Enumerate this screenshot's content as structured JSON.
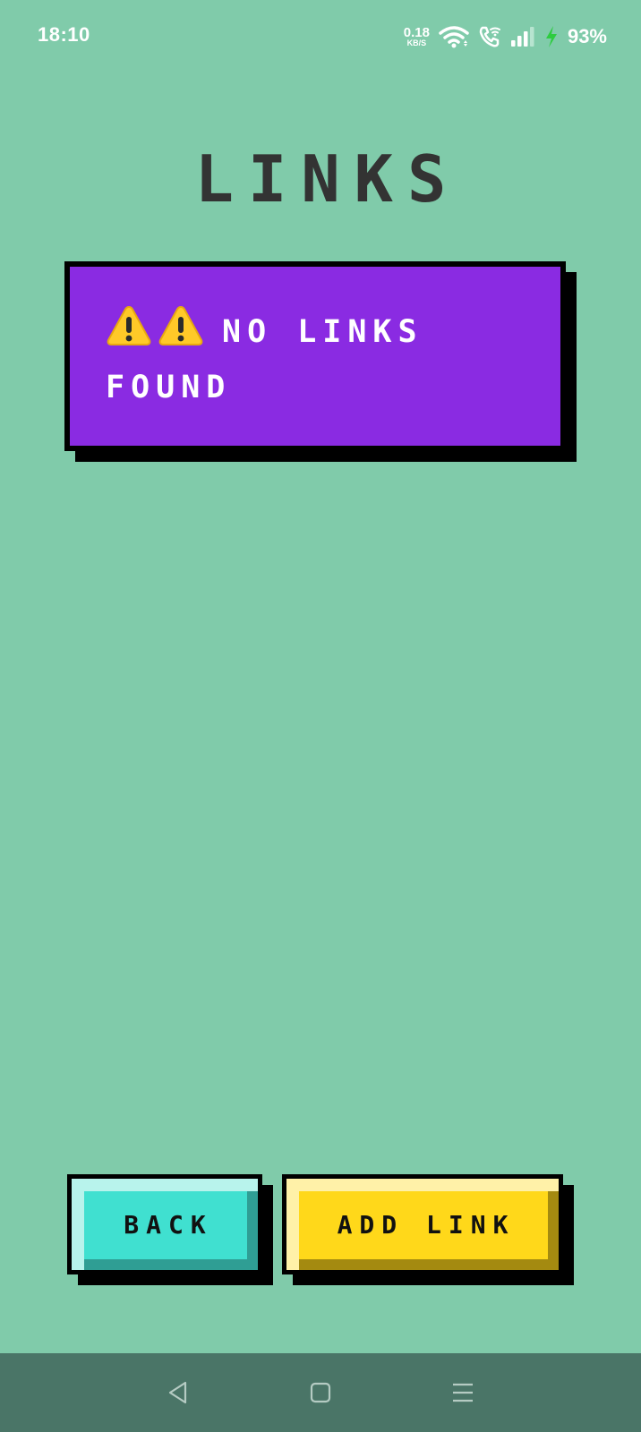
{
  "status_bar": {
    "time": "18:10",
    "net_speed_value": "0.18",
    "net_speed_unit": "KB/S",
    "battery_percent": "93%",
    "icons": [
      "wifi-icon",
      "wifi-call-icon",
      "signal-icon",
      "charging-icon"
    ]
  },
  "page": {
    "title": "LINKS"
  },
  "empty_state": {
    "icons": [
      "warning-icon",
      "warning-icon"
    ],
    "message": "NO LINKS FOUND"
  },
  "buttons": {
    "back_label": "BACK",
    "add_link_label": "ADD LINK"
  },
  "nav_bar": {
    "icons": [
      "back-triangle-icon",
      "home-square-icon",
      "menu-lines-icon"
    ]
  },
  "colors": {
    "background": "#80cbaa",
    "title": "#333333",
    "card": "#8a2be2",
    "back_button": "#40e0d0",
    "add_button": "#ffd81a",
    "nav_bar": "#4a7567",
    "charging": "#2ecc40"
  }
}
